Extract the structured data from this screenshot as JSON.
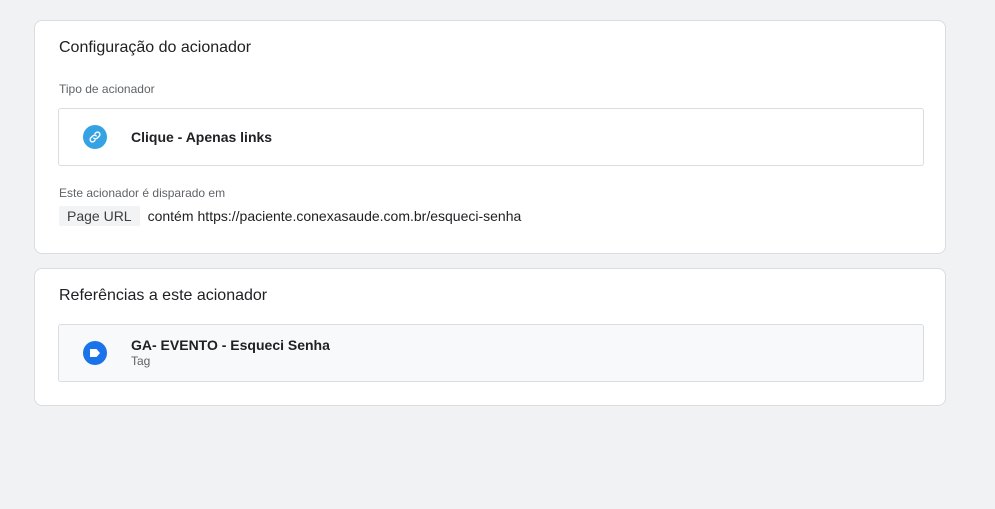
{
  "trigger_config": {
    "title": "Configuração do acionador",
    "type_label": "Tipo de acionador",
    "type": {
      "icon": "link-icon",
      "icon_color": "#35a3e3",
      "name": "Clique - Apenas links"
    },
    "fires_on_label": "Este acionador é disparado em",
    "condition": {
      "variable": "Page URL",
      "operator": "contém",
      "value": "https://paciente.conexasaude.com.br/esqueci-senha"
    }
  },
  "references": {
    "title": "Referências a este acionador",
    "items": [
      {
        "icon": "tag-icon",
        "icon_color": "#1a73e8",
        "name": "GA- EVENTO - Esqueci Senha",
        "type": "Tag"
      }
    ]
  }
}
